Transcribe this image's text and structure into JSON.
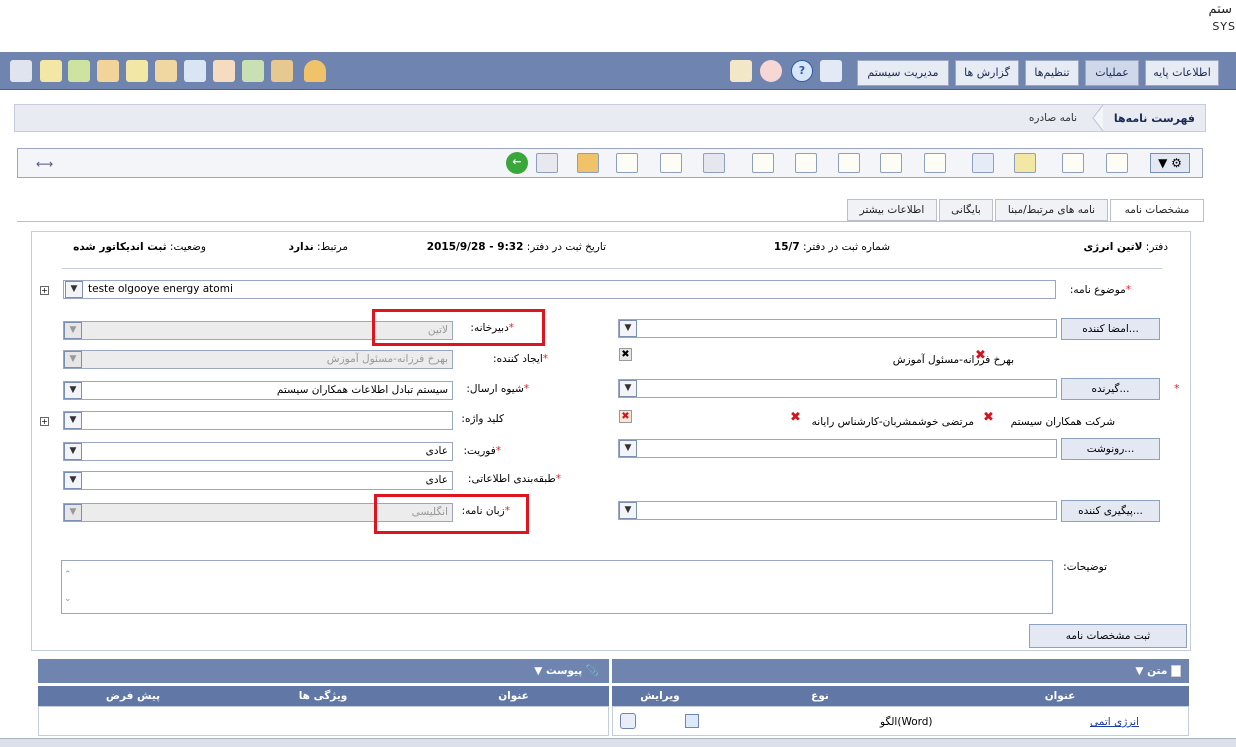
{
  "brand": {
    "line1": "ستم",
    "line2": "SYS"
  },
  "top_menu": {
    "tabs": [
      "اطلاعات پایه",
      "عملیات",
      "تنظیم‌ها",
      "گزارش ها",
      "مدیریت سیستم"
    ],
    "active": "عملیات"
  },
  "breadcrumb": {
    "title": "فهرست نامه‌ها",
    "sub": "نامه صادره"
  },
  "form_tabs": [
    "مشخصات نامه",
    "نامه های مرتبط/مبنا",
    "بایگانی",
    "اطلاعات بیشتر"
  ],
  "info": {
    "office_label": "دفتر:",
    "office_value": "لاتین انرژی",
    "regno_label": "شماره ثبت در دفتر:",
    "regno_value": "15/7",
    "regdate_label": "تاریخ ثبت در دفتر:",
    "regdate_value": "2015/9/28 - 9:32",
    "related_label": "مرتبط:",
    "related_value": "ندارد",
    "status_label": "وضعیت:",
    "status_value": "ثبت اندیکاتور شده"
  },
  "subject": {
    "label": "موضوع نامه:",
    "value": "teste olgooye energy atomi"
  },
  "secretariat": {
    "label": "دبیرخانه:",
    "value": "لاتین"
  },
  "creator": {
    "label": "ایجاد کننده:",
    "value": "بهرخ فرزانه-مسئول آموزش"
  },
  "send_method": {
    "label": "شیوه ارسال:",
    "value": "سیستم تبادل اطلاعات همکاران سیستم"
  },
  "keyword": {
    "label": "کلید واژه:",
    "value": ""
  },
  "urgency": {
    "label": "فوریت:",
    "value": "عادی"
  },
  "classification": {
    "label": "طبقه‌بندی اطلاعاتی:",
    "value": "عادی"
  },
  "language": {
    "label": "زبان نامه:",
    "value": "انگلیسی"
  },
  "signers_btn": "امضا کننده...",
  "signer_entry": "بهرخ فرزانه-مسئول آموزش",
  "recipient_btn": "گیرنده...",
  "recipient_entries": [
    "شرکت همکاران سیستم",
    "مرتضی خوشمشربان-کارشناس رایانه"
  ],
  "cc_btn": "رونوشت...",
  "followup_btn": "پیگیری کننده...",
  "notes_label": "توضیحات:",
  "save_btn": "ثبت مشخصات نامه",
  "text_grid": {
    "title": "متن",
    "cols": [
      "عنوان",
      "نوع",
      "ویرایش"
    ],
    "row": {
      "title": "انرژی اتمی",
      "type": "الگو(Word)"
    }
  },
  "post_grid": {
    "title": "پیوست",
    "cols": [
      "عنوان",
      "ویژگی ها",
      "پیش فرض"
    ]
  },
  "colors": {
    "bar": "#6f85b0",
    "required": "#e2222d",
    "highlight": "#e0141e"
  }
}
